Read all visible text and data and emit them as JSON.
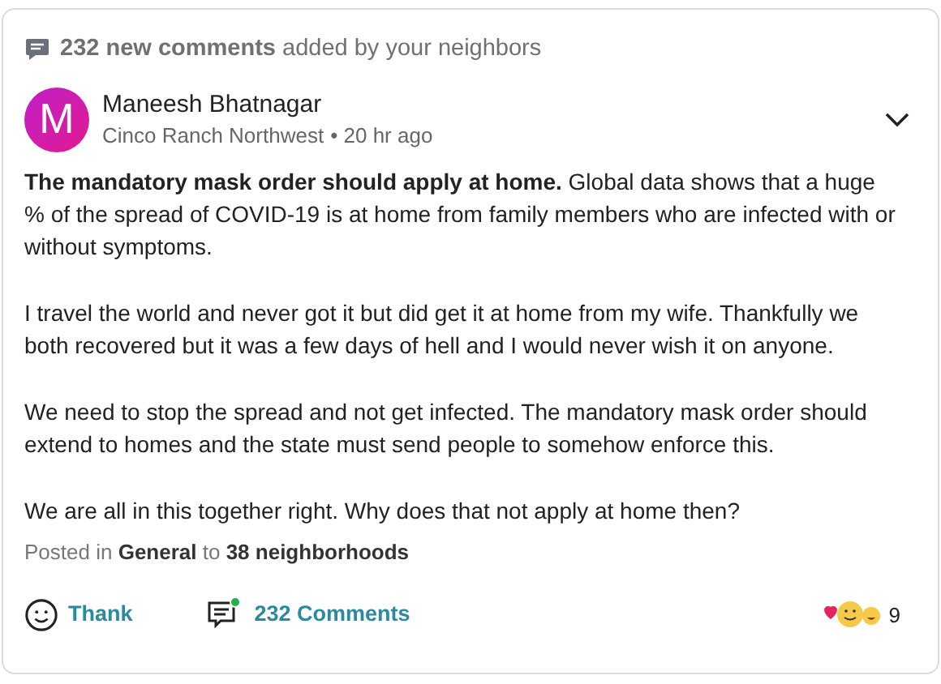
{
  "banner": {
    "text": "**232 new comments** added by your neighbors"
  },
  "post": {
    "avatar_letter": "M",
    "author": "Maneesh Bhatnagar",
    "neighborhood": "Cinco Ranch Northwest",
    "separator": "•",
    "time": "20 hr ago",
    "paragraphs": [
      "**The mandatory mask order should apply at home.** Global data shows that a huge % of the spread of COVID-19 is at home from family members who are infected with or without symptoms.",
      "I travel the world and never got it but did get it at home from my wife. Thankfully we both recovered but it was a few days of hell and I would never wish it on anyone.",
      "We need to stop the spread and not get infected. The mandatory mask order should extend to homes and the state must send people to somehow enforce this.",
      "We are all in this together right. Why does that not apply at home then?"
    ],
    "posted_in": "Posted in **General** to **38 neighborhoods**"
  },
  "actions": {
    "thank": "Thank",
    "comments": "232 Comments",
    "comments_new": true,
    "reaction_count": "9"
  }
}
